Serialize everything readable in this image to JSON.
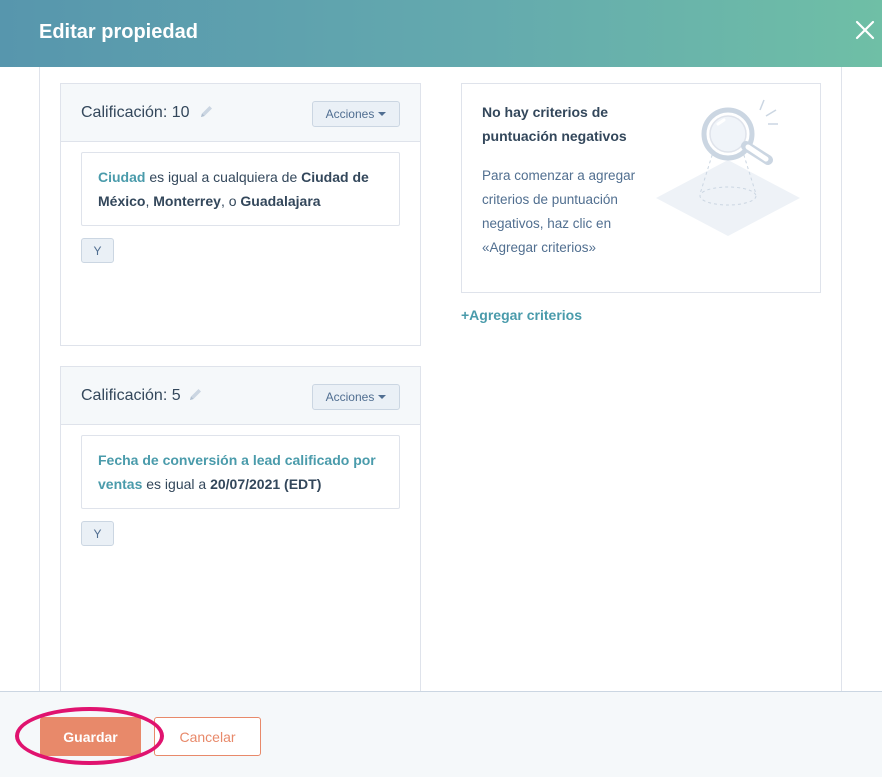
{
  "header": {
    "title": "Editar propiedad"
  },
  "rules": [
    {
      "score_label": "Calificación: 10",
      "actions_label": "Acciones",
      "criteria": {
        "field": "Ciudad",
        "operator": " es igual a cualquiera de ",
        "values": [
          "Ciudad de México",
          "Monterrey",
          "Guadalajara"
        ],
        "sep1": ", ",
        "sep2": ", o "
      },
      "and_label": "Y"
    },
    {
      "score_label": "Calificación: 5",
      "actions_label": "Acciones",
      "criteria": {
        "field": "Fecha de conversión a lead calificado por ventas",
        "operator": " es igual a ",
        "value": "20/07/2021 (EDT)"
      },
      "and_label": "Y"
    }
  ],
  "negative": {
    "title": "No hay criterios de puntuación negativos",
    "description": "Para comenzar a agregar criterios de puntuación negativos, haz clic en «Agregar criterios»",
    "add_link": "+Agregar criterios",
    "illustration_icon": "magnifying-glass-icon"
  },
  "footer": {
    "save_label": "Guardar",
    "cancel_label": "Cancelar"
  },
  "colors": {
    "accent": "#e8896a",
    "link": "#4a9bab",
    "highlight": "#e0136f"
  }
}
